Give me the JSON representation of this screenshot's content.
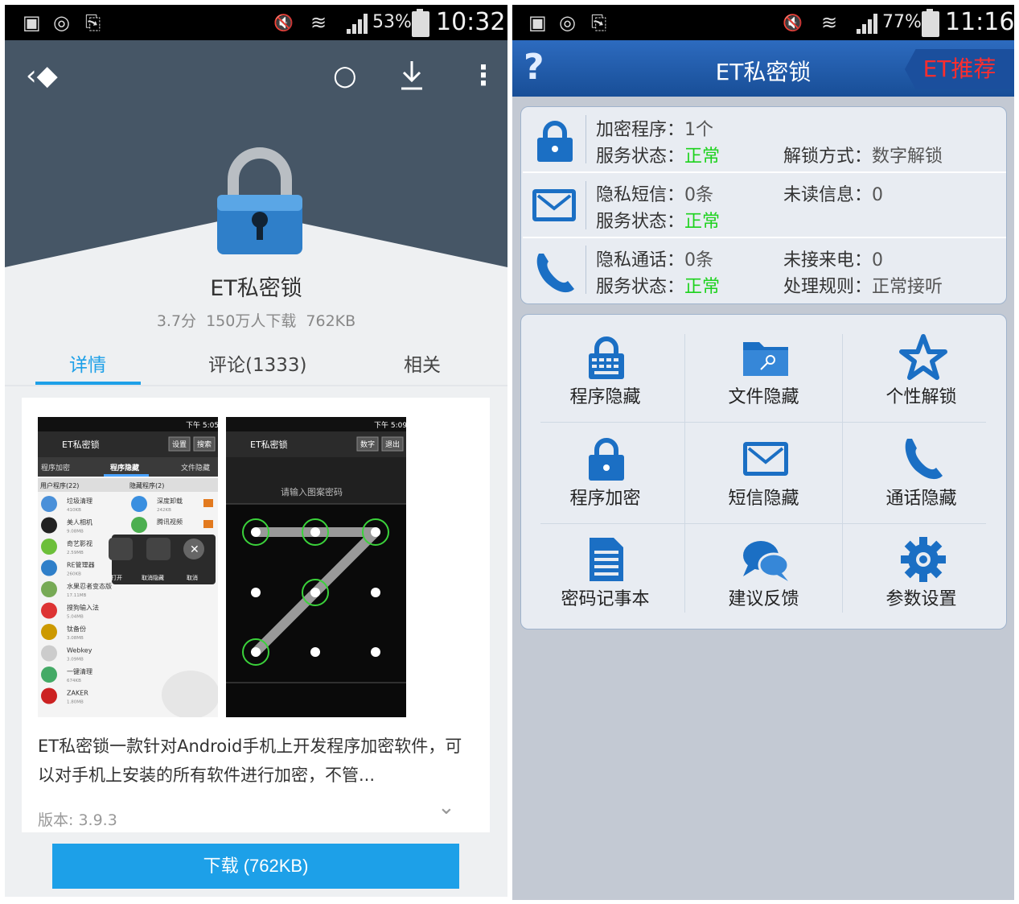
{
  "left": {
    "status": {
      "battery": "53%",
      "time": "10:32"
    },
    "app_name": "ET私密锁",
    "meta": {
      "rating": "3.7分",
      "downloads": "150万人下载",
      "size": "762KB"
    },
    "tabs": [
      {
        "label": "详情"
      },
      {
        "label": "评论(1333)"
      },
      {
        "label": "相关"
      }
    ],
    "description": "ET私密锁一款针对Android手机上开发程序加密软件，可以对手机上安装的所有软件进行加密，不管...",
    "version": "版本: 3.9.3",
    "download_button": "下载 (762KB)"
  },
  "right": {
    "status": {
      "battery": "77%",
      "time": "11:16"
    },
    "title": "ET私密锁",
    "help": "?",
    "recommend": "ET推荐",
    "colors": {
      "ok": "#1dd21d",
      "header": "#2d6bbf",
      "recommend": "#ff2d2d"
    },
    "rows": [
      {
        "icon": "lock-icon",
        "a_label": "加密程序：",
        "a_value": "1个",
        "b_label": "服务状态：",
        "b_value": "正常",
        "c_label": "",
        "c_value": "",
        "d_label": "解锁方式：",
        "d_value": "数字解锁"
      },
      {
        "icon": "mail-icon",
        "a_label": "隐私短信：",
        "a_value": "0条",
        "b_label": "服务状态：",
        "b_value": "正常",
        "c_label": "未读信息：",
        "c_value": "0",
        "d_label": "",
        "d_value": ""
      },
      {
        "icon": "phone-icon",
        "a_label": "隐私通话：",
        "a_value": "0条",
        "b_label": "服务状态：",
        "b_value": "正常",
        "c_label": "未接来电：",
        "c_value": "0",
        "d_label": "处理规则：",
        "d_value": "正常接听"
      }
    ],
    "grid": [
      {
        "label": "程序隐藏",
        "icon": "keyboard-lock-icon"
      },
      {
        "label": "文件隐藏",
        "icon": "folder-key-icon"
      },
      {
        "label": "个性解锁",
        "icon": "star-icon"
      },
      {
        "label": "程序加密",
        "icon": "padlock-icon"
      },
      {
        "label": "短信隐藏",
        "icon": "envelope-icon"
      },
      {
        "label": "通话隐藏",
        "icon": "handset-icon"
      },
      {
        "label": "密码记事本",
        "icon": "notepad-icon"
      },
      {
        "label": "建议反馈",
        "icon": "chat-bubbles-icon"
      },
      {
        "label": "参数设置",
        "icon": "gear-icon"
      }
    ]
  },
  "screenshot_left": {
    "status_time": "下午 5:05",
    "title": "ET私密锁",
    "buttons": [
      "设置",
      "搜索"
    ],
    "tabs": [
      "程序加密",
      "程序隐藏",
      "文件隐藏"
    ],
    "col_headers": [
      "用户程序(22)",
      "隐藏程序(2)"
    ],
    "apps": [
      {
        "name": "垃圾清理",
        "size": "410KB"
      },
      {
        "name": "美人相机",
        "size": "9.08MB"
      },
      {
        "name": "奇艺影视",
        "size": "2.59MB"
      },
      {
        "name": "RE管理器",
        "size": "260KB"
      },
      {
        "name": "水果忍者变态版",
        "size": "17.11MB"
      },
      {
        "name": "搜狗输入法",
        "size": "5.04MB"
      },
      {
        "name": "钛备份",
        "size": "3.08MB"
      },
      {
        "name": "Webkey",
        "size": "3.09MB"
      },
      {
        "name": "一键清理",
        "size": "674KB"
      },
      {
        "name": "ZAKER",
        "size": "1.80MB"
      }
    ],
    "hidden": [
      {
        "name": "深度卸载",
        "size": "242KB"
      },
      {
        "name": "腾讯视频",
        "size": ""
      }
    ],
    "popup": [
      "打开",
      "取消隐藏",
      "取消"
    ]
  },
  "screenshot_right": {
    "status_time": "下午 5:09",
    "title": "ET私密锁",
    "buttons": [
      "数字",
      "退出"
    ],
    "prompt": "请输入图案密码"
  }
}
